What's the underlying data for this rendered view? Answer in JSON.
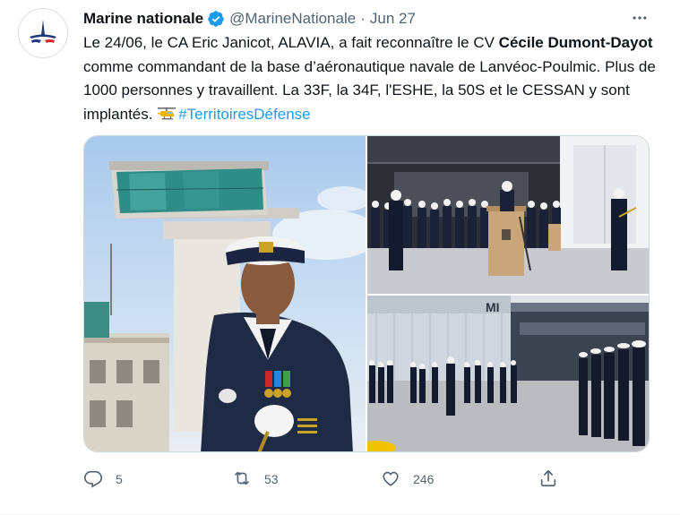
{
  "tweet": {
    "author_name": "Marine nationale",
    "author_handle": "@MarineNationale",
    "separator": "·",
    "date": "Jun 27",
    "text_parts": {
      "part1": "Le 24/06, le CA Eric Janicot, ALAVIA, a fait reconnaître le CV ",
      "bold": "Cécile Dumont-Dayot",
      "part2": " comme commandant de la base d’aéronautique navale de Lanvéoc-Poulmic. Plus de 1000 personnes y travaillent. La 33F, la 34F, l'ESHE, la 50S et le CESSAN y sont implantés. ",
      "hashtag": "#TerritoiresDéfense"
    },
    "hangar_sign": "MI"
  },
  "actions": {
    "reply_count": "5",
    "retweet_count": "53",
    "like_count": "246"
  },
  "icons": {
    "verified": "verified-badge-icon",
    "more": "more-options-icon",
    "reply": "reply-icon",
    "retweet": "retweet-icon",
    "like": "heart-icon",
    "share": "share-icon",
    "helicopter": "helicopter-emoji"
  },
  "colors": {
    "accent": "#1d9bf0",
    "secondary_text": "#536471",
    "primary_text": "#0f1419"
  }
}
